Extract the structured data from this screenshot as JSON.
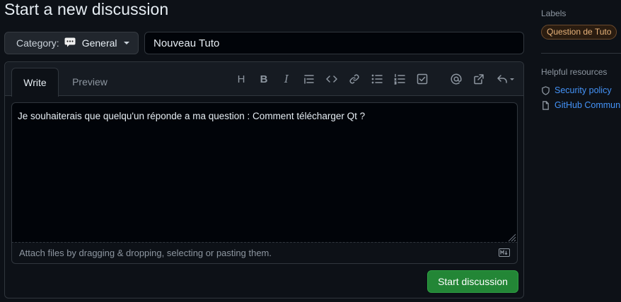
{
  "page": {
    "title": "Start a new discussion"
  },
  "category": {
    "prefix": "Category:",
    "value": "General"
  },
  "discussion_title": {
    "value": "Nouveau Tuto"
  },
  "editor": {
    "tabs": {
      "write": "Write",
      "preview": "Preview"
    },
    "toolbar_icons": [
      "heading-icon",
      "bold-icon",
      "italic-icon",
      "quote-icon",
      "code-icon",
      "link-icon",
      "unordered-list-icon",
      "ordered-list-icon",
      "task-list-icon",
      "mention-icon",
      "cross-reference-icon",
      "reply-icon"
    ],
    "toolbar_heading_glyph": "H",
    "toolbar_bold_glyph": "B",
    "toolbar_italic_glyph": "I",
    "body": "Je souhaiterais que quelqu'un réponde a ma question : Comment télécharger Qt ?",
    "attach_hint": "Attach files by dragging & dropping, selecting or pasting them."
  },
  "submit": {
    "label": "Start discussion"
  },
  "sidebar": {
    "labels_heading": "Labels",
    "label": "Question de Tuto",
    "resources_heading": "Helpful resources",
    "resources": [
      {
        "icon": "shield-icon",
        "label": "Security policy"
      },
      {
        "icon": "file-icon",
        "label": "GitHub Communi"
      }
    ]
  },
  "colors": {
    "background": "#0d1117",
    "accent_link": "#4493f8",
    "submit_green": "#238636",
    "label_orange": "#e8b37a"
  }
}
